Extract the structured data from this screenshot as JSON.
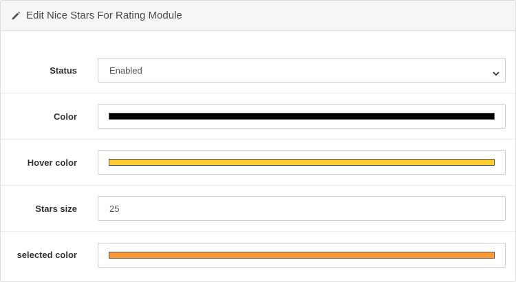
{
  "header": {
    "icon": "pencil-icon",
    "title": "Edit Nice Stars For Rating Module"
  },
  "form": {
    "status": {
      "label": "Status",
      "value": "Enabled"
    },
    "color": {
      "label": "Color",
      "value": "#000000"
    },
    "hover_color": {
      "label": "Hover color",
      "value": "#ffcc33"
    },
    "stars_size": {
      "label": "Stars size",
      "value": "25"
    },
    "selected_color": {
      "label": "selected color",
      "value": "#ff9933"
    }
  }
}
